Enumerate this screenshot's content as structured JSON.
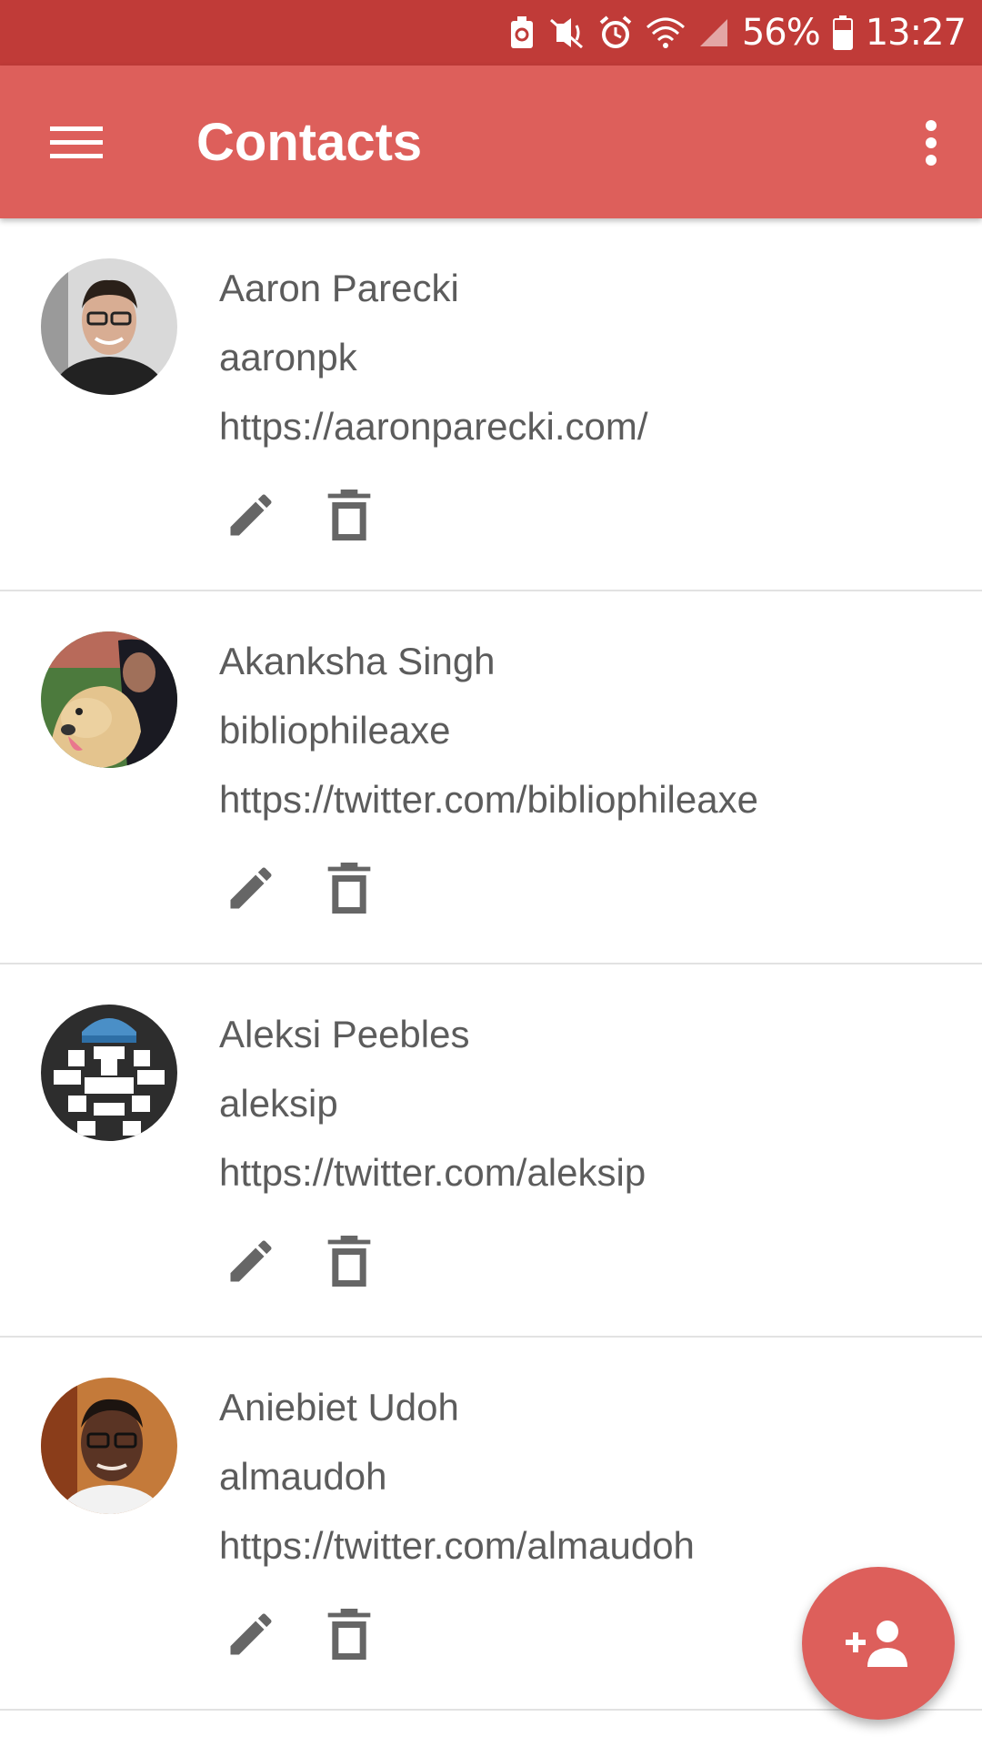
{
  "status_bar": {
    "battery_percent": "56%",
    "time": "13:27",
    "icons": [
      "recycle-notification-icon",
      "vibrate-icon",
      "alarm-icon",
      "wifi-icon",
      "signal-icon",
      "battery-icon"
    ]
  },
  "app_bar": {
    "title": "Contacts",
    "icons": [
      "menu-icon",
      "more-vert-icon"
    ]
  },
  "contacts": [
    {
      "name": "Aaron Parecki",
      "username": "aaronpk",
      "url": "https://aaronparecki.com/",
      "avatar": "avatar-photo-man-glasses"
    },
    {
      "name": "Akanksha Singh",
      "username": "bibliophileaxe",
      "url": "https://twitter.com/bibliophileaxe",
      "avatar": "avatar-photo-woman-dog"
    },
    {
      "name": "Aleksi Peebles",
      "username": "aleksip",
      "url": "https://twitter.com/aleksip",
      "avatar": "avatar-pixel-art"
    },
    {
      "name": "Aniebiet Udoh",
      "username": "almaudoh",
      "url": "https://twitter.com/almaudoh",
      "avatar": "avatar-photo-man-glasses-2"
    }
  ],
  "actions": {
    "edit_icon": "pencil-icon",
    "delete_icon": "trash-icon"
  },
  "fab": {
    "icon": "add-person-icon"
  },
  "colors": {
    "status_bar": "#c03b38",
    "app_bar": "#dd5f5b",
    "fab": "#dd5f5b",
    "text": "#5c5c5c",
    "icon": "#666666",
    "divider": "#e2e2e2"
  }
}
